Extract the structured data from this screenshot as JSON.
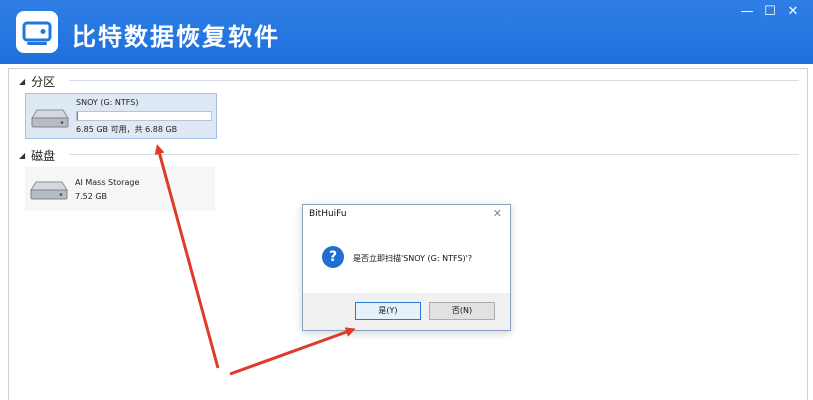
{
  "window": {
    "title": "比特数据恢复软件",
    "minimize": "—",
    "maximize": "☐",
    "close": "✕"
  },
  "sections": {
    "partition_label": "分区",
    "disk_label": "磁盘"
  },
  "partition": {
    "name": "SNOY (G: NTFS)",
    "usage_text": "6.85 GB 可用，共 6.88 GB",
    "used_fraction": 0.004
  },
  "disk": {
    "name": "AI Mass Storage",
    "size": "7.52 GB"
  },
  "dialog": {
    "title": "BitHuiFu",
    "close": "✕",
    "icon": "question-icon",
    "message": "是否立即扫描'SNOY (G: NTFS)'?",
    "yes_label": "是(Y)",
    "no_label": "否(N)"
  },
  "colors": {
    "titlebar": "#2077e0",
    "accent": "#1f6fd0",
    "annotation_arrow": "#e03a2a"
  }
}
